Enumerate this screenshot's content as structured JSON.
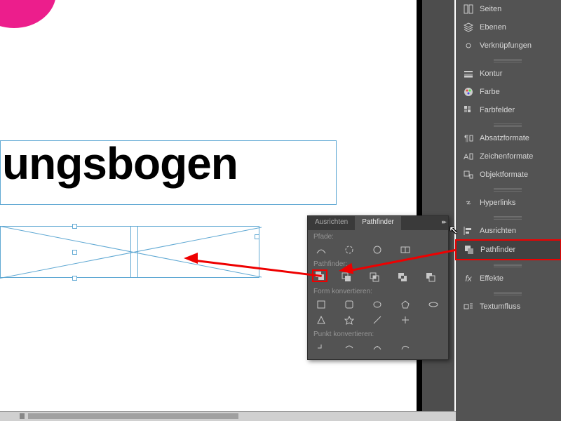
{
  "canvas": {
    "text": "ungsbogen"
  },
  "sidebar": {
    "groups": [
      [
        {
          "icon": "pages",
          "label": "Seiten"
        },
        {
          "icon": "layers",
          "label": "Ebenen"
        },
        {
          "icon": "links",
          "label": "Verknüpfungen"
        }
      ],
      [
        {
          "icon": "stroke",
          "label": "Kontur"
        },
        {
          "icon": "color",
          "label": "Farbe"
        },
        {
          "icon": "swatches",
          "label": "Farbfelder"
        }
      ],
      [
        {
          "icon": "para-style",
          "label": "Absatzformate"
        },
        {
          "icon": "char-style",
          "label": "Zeichenformate"
        },
        {
          "icon": "obj-style",
          "label": "Objektformate"
        }
      ],
      [
        {
          "icon": "hyperlink",
          "label": "Hyperlinks"
        }
      ],
      [
        {
          "icon": "align",
          "label": "Ausrichten"
        },
        {
          "icon": "pathfinder",
          "label": "Pathfinder",
          "selected": true
        }
      ],
      [
        {
          "icon": "fx",
          "label": "Effekte"
        }
      ],
      [
        {
          "icon": "textwrap",
          "label": "Textumfluss"
        }
      ]
    ]
  },
  "popup": {
    "tabs": [
      {
        "label": "Ausrichten",
        "active": false
      },
      {
        "label": "Pathfinder",
        "active": true
      }
    ],
    "sections": {
      "paths": "Pfade:",
      "pathfinder": "Pathfinder:",
      "convert_shape": "Form konvertieren:",
      "convert_point": "Punkt konvertieren:"
    }
  }
}
